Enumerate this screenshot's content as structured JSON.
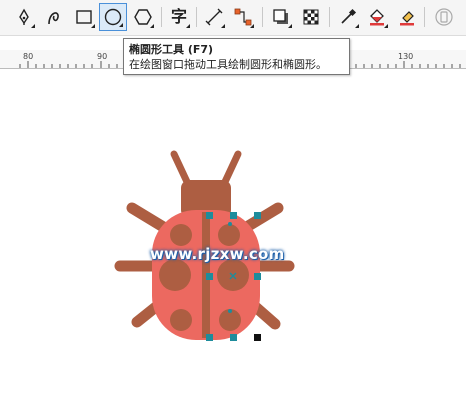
{
  "toolbar": {
    "tools": [
      {
        "name": "freehand-pen-tool",
        "icon": "pen-nib-icon"
      },
      {
        "name": "artistic-media-tool",
        "icon": "curve-icon"
      },
      {
        "name": "rectangle-tool",
        "icon": "rectangle-icon"
      },
      {
        "name": "ellipse-tool",
        "icon": "ellipse-icon",
        "active": true
      },
      {
        "name": "polygon-tool",
        "icon": "hexagon-icon"
      },
      {
        "name": "text-tool",
        "icon": "text-glyph",
        "label": "字"
      },
      {
        "name": "line-connector-tool",
        "icon": "line-connector-icon"
      },
      {
        "name": "dimension-tool",
        "icon": "connector-icon"
      },
      {
        "name": "drop-shadow-tool",
        "icon": "drop-shadow-icon"
      },
      {
        "name": "transparency-tool",
        "icon": "checker-icon"
      },
      {
        "name": "eyedropper-tool",
        "icon": "eyedropper-icon"
      },
      {
        "name": "interactive-fill-tool",
        "icon": "paint-bucket-icon"
      },
      {
        "name": "smart-fill-tool",
        "icon": "eraser-fill-icon"
      },
      {
        "name": "object-manager-tool",
        "icon": "object-icon"
      }
    ],
    "accent_color": "#4a90d9"
  },
  "ruler": {
    "labels": [
      "80",
      "90",
      "130"
    ]
  },
  "tooltip": {
    "title": "椭圆形工具 (F7)",
    "description": "在绘图窗口拖动工具绘制圆形和椭圆形。"
  },
  "canvas": {
    "watermark": "www.rjzxw.com",
    "colors": {
      "ladybug_body": "#ec6960",
      "ladybug_dark": "#ad5e42",
      "selection_handle": "#1e8c9c"
    }
  }
}
